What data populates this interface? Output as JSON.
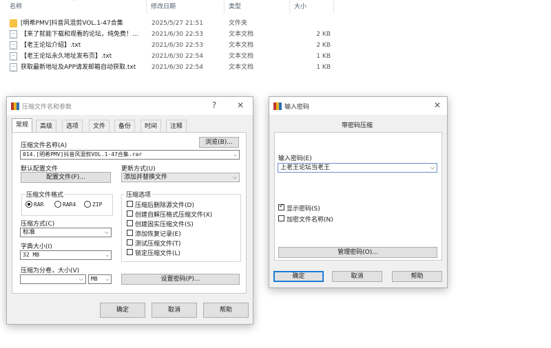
{
  "explorer": {
    "columns": {
      "name": "名称",
      "date": "修改日期",
      "type": "类型",
      "size": "大小"
    },
    "sort_indicator": "^",
    "files": [
      {
        "icon": "folder-icon",
        "name": "[明希PMV]抖音风混剪VOL.1-47合集",
        "date": "2025/5/27 21:51",
        "type": "文件夹",
        "size": ""
      },
      {
        "icon": "text-file-icon",
        "name": "【来了就能下载和观看的论坛，纯免费！...",
        "date": "2021/6/30 22:53",
        "type": "文本文档",
        "size": "2 KB"
      },
      {
        "icon": "text-file-icon",
        "name": "【老王论坛介绍】.txt",
        "date": "2021/6/30 22:53",
        "type": "文本文档",
        "size": "2 KB"
      },
      {
        "icon": "text-file-icon",
        "name": "【老王论坛永久地址发布页】.txt",
        "date": "2021/6/30 22:54",
        "type": "文本文档",
        "size": "1 KB"
      },
      {
        "icon": "text-file-icon",
        "name": "获取最新地址及APP请发邮箱自动获取.txt",
        "date": "2021/6/30 22:54",
        "type": "文本文档",
        "size": "1 KB"
      }
    ]
  },
  "archive_dialog": {
    "title": "压缩文件名和参数",
    "help_glyph": "?",
    "close_glyph": "✕",
    "tabs": [
      "常规",
      "高级",
      "选项",
      "文件",
      "备份",
      "时间",
      "注释"
    ],
    "archive_name_label": "压缩文件名称(A)",
    "browse_button": "浏览(B)...",
    "archive_name_value": "014.[明希PMV]抖音风混剪VOL.1-47合集.rar",
    "default_profile_label": "默认配置文件",
    "profile_button": "配置文件(F)...",
    "update_mode_label": "更新方式(U)",
    "update_mode_value": "添加并替换文件",
    "format_group_label": "压缩文件格式",
    "formats": [
      "RAR",
      "RAR4",
      "ZIP"
    ],
    "selected_format": "RAR",
    "options_group_label": "压缩选项",
    "options": [
      {
        "label": "压缩后删除源文件(D)",
        "checked": false
      },
      {
        "label": "创建自解压格式压缩文件(X)",
        "checked": false
      },
      {
        "label": "创建固实压缩文件(S)",
        "checked": false
      },
      {
        "label": "添加恢复记录(E)",
        "checked": false
      },
      {
        "label": "测试压缩文件(T)",
        "checked": false
      },
      {
        "label": "锁定压缩文件(L)",
        "checked": false
      }
    ],
    "method_label": "压缩方式(C)",
    "method_value": "标准",
    "dict_label": "字典大小(I)",
    "dict_value": "32 MB",
    "split_label": "压缩为分卷，大小(V)",
    "split_value": "",
    "split_unit": "MB",
    "set_password_button": "设置密码(P)...",
    "ok": "确定",
    "cancel": "取消",
    "help": "帮助"
  },
  "password_dialog": {
    "title": "输入密码",
    "close_glyph": "✕",
    "heading": "带密码压缩",
    "password_label": "输入密码(E)",
    "password_value": "上老王论坛当老王",
    "show_password_label": "显示密码(S)",
    "show_password_checked": true,
    "encrypt_names_label": "加密文件名称(N)",
    "encrypt_names_checked": false,
    "manage_button": "管理密码(O)...",
    "ok": "确定",
    "cancel": "取消",
    "help": "帮助"
  }
}
